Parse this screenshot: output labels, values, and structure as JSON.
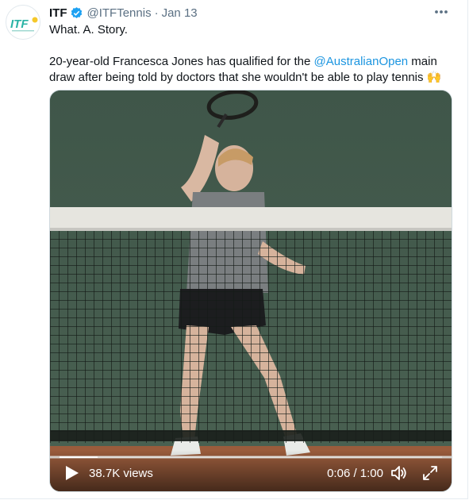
{
  "tweet": {
    "author_name": "ITF",
    "handle": "@ITFTennis",
    "separator": "·",
    "date": "Jan 13",
    "avatar_text": "ITF",
    "verified": true,
    "lines": {
      "first": "What. A. Story.",
      "second_pre": "20-year-old Francesca Jones has qualified for the ",
      "mention": "@AustralianOpen",
      "second_post": " main",
      "third": "draw after being told by doctors that she wouldn't be able to play tennis 🙌"
    }
  },
  "video": {
    "views": "38.7K views",
    "time": "0:06 / 1:00",
    "progress_fraction": 0.1
  },
  "colors": {
    "mention": "#1b95e0",
    "verified": "#1da1f2",
    "avatar_text": "#2bb3a5",
    "avatar_ball": "#f5c82b",
    "muted": "#5b7083"
  },
  "icons": {
    "more": "more-icon",
    "verified": "verified-badge-icon",
    "play": "play-icon",
    "volume": "volume-muted-icon",
    "fullscreen": "fullscreen-icon"
  }
}
